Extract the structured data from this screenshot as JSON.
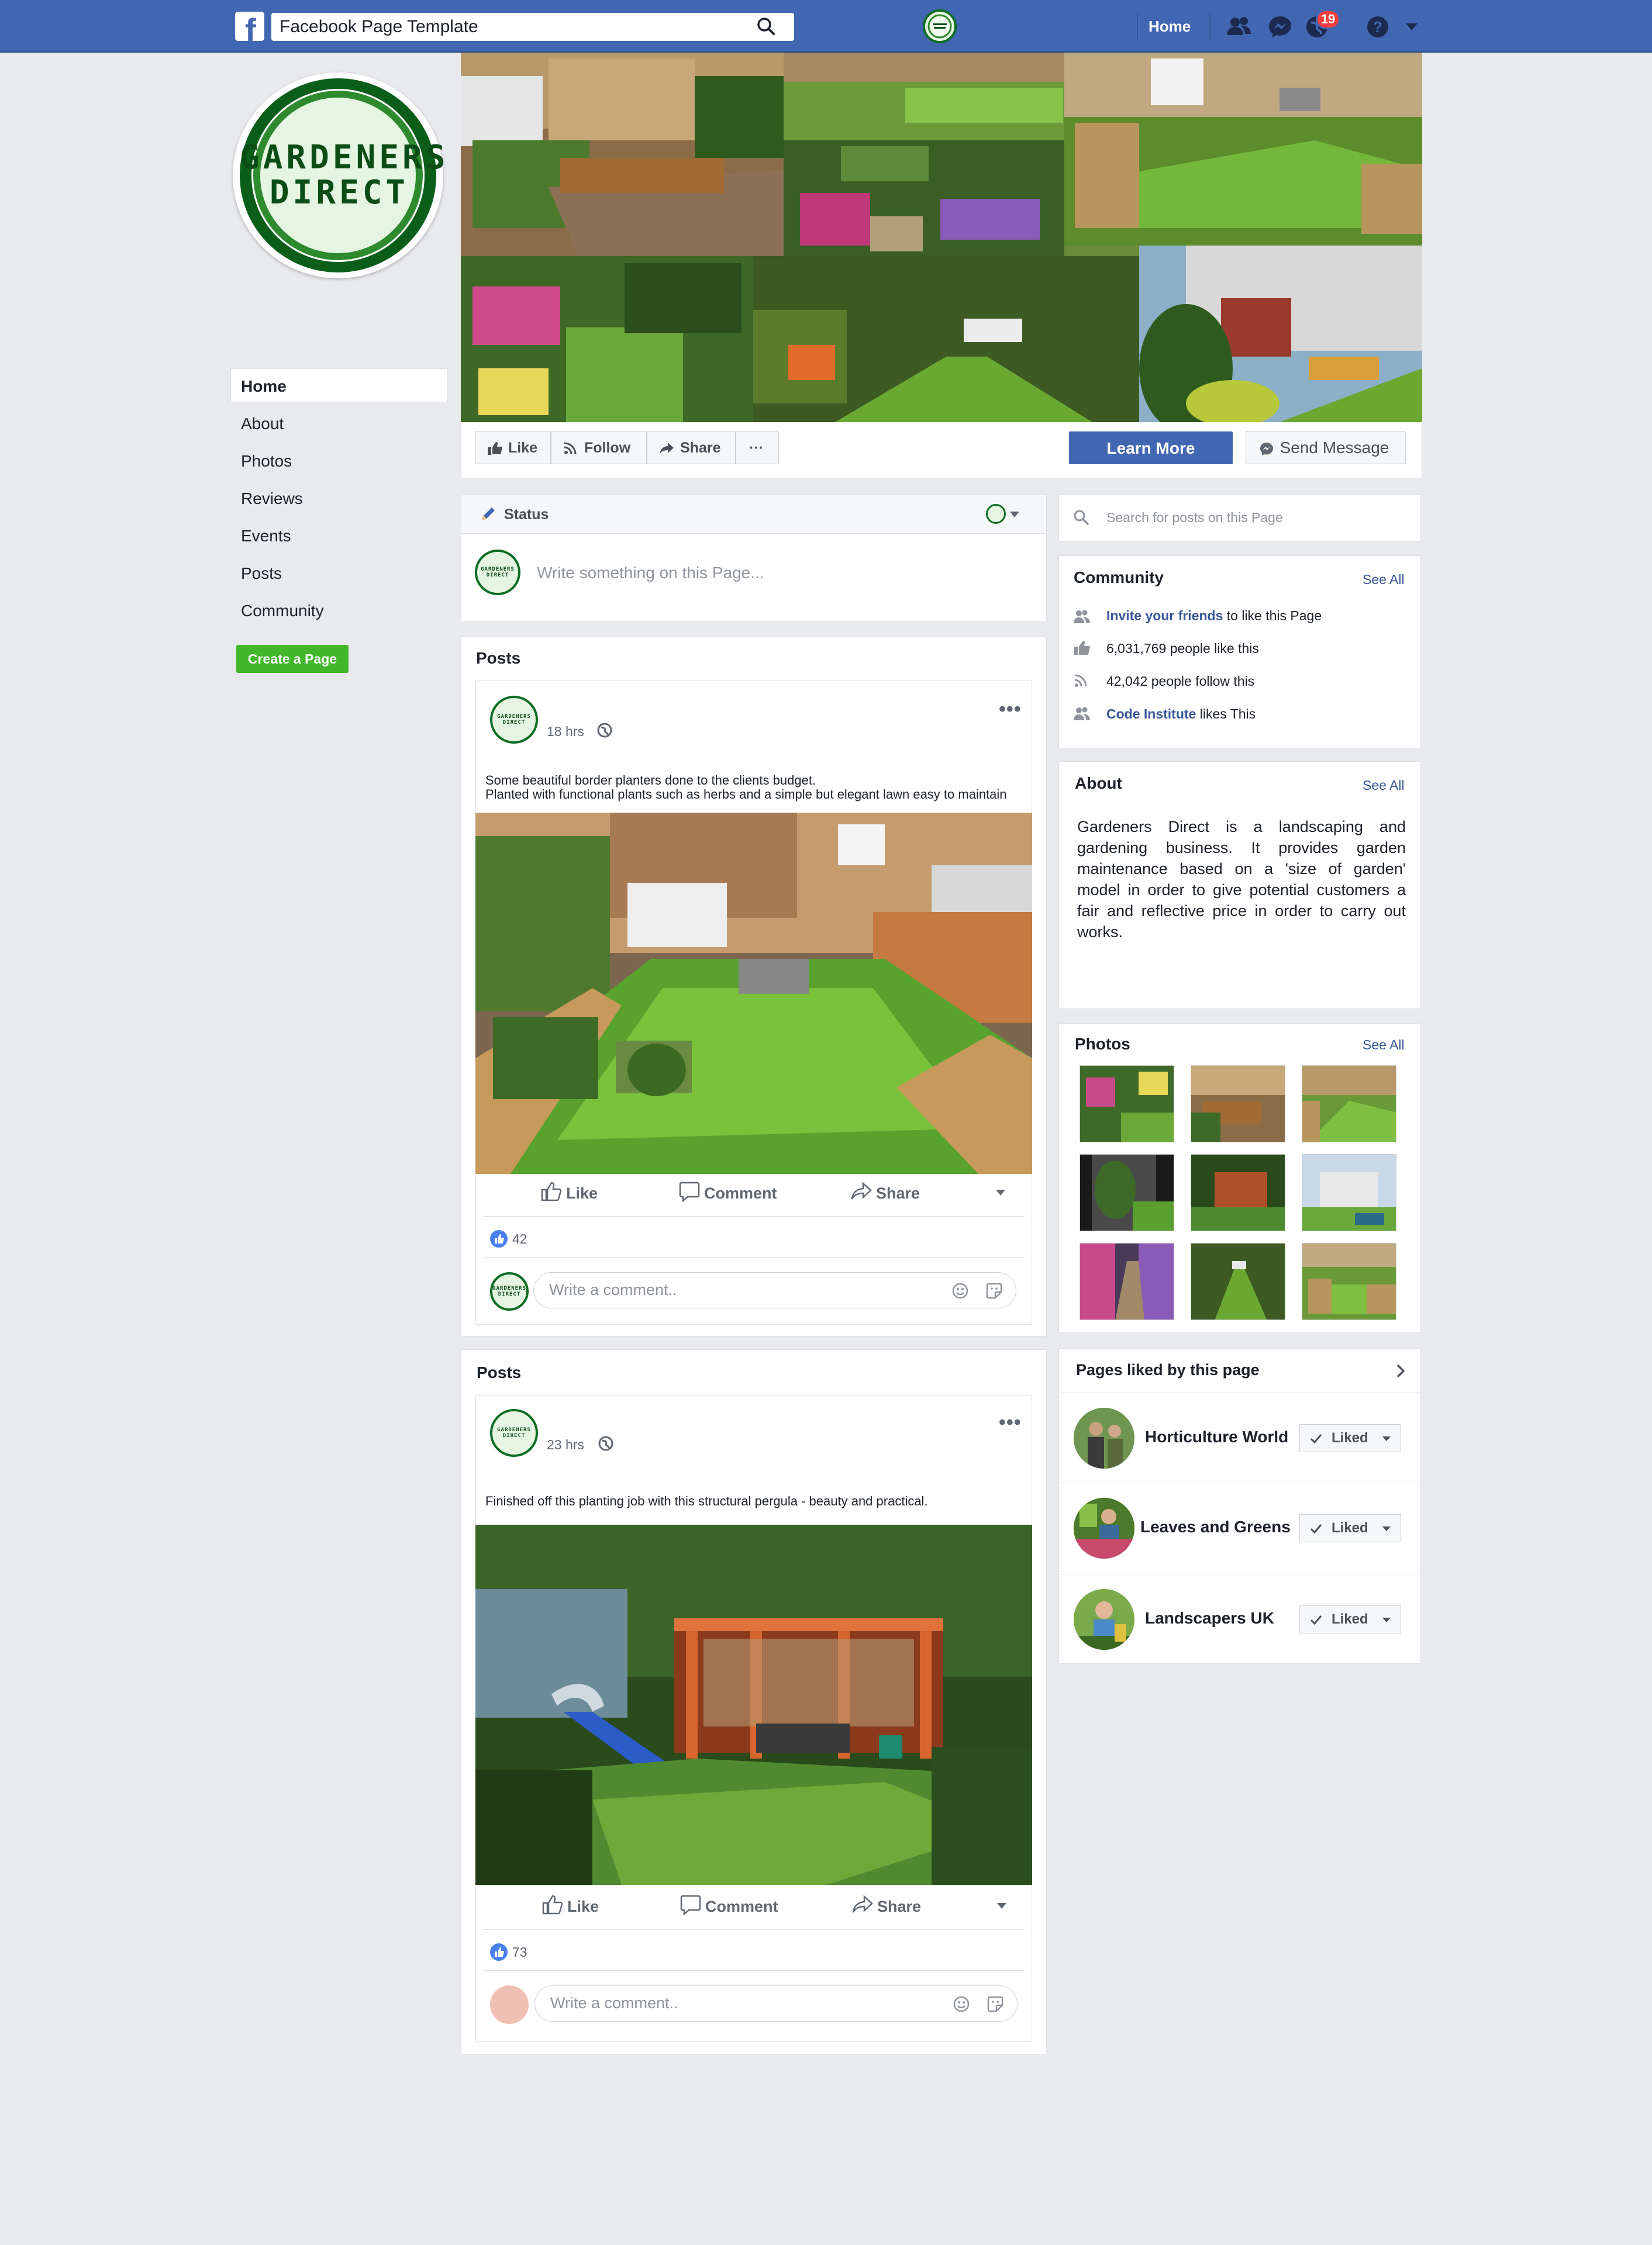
{
  "topbar": {
    "search_value": "Facebook Page Template",
    "home": "Home",
    "notification_count": "19"
  },
  "profile": {
    "logo_line1": "GARDENERS",
    "logo_line2": "DIRECT",
    "avatar_text": "GARDENERS DIRECT"
  },
  "left_nav": {
    "items": [
      "Home",
      "About",
      "Photos",
      "Reviews",
      "Events",
      "Posts",
      "Community"
    ],
    "create_page": "Create a Page"
  },
  "actions": {
    "like": "Like",
    "follow": "Follow",
    "share": "Share",
    "more": "···",
    "learn_more": "Learn More",
    "send_message": "Send Message"
  },
  "composer": {
    "status": "Status",
    "placeholder": "Write something on this Page..."
  },
  "posts": [
    {
      "heading": "Posts",
      "time": "18 hrs",
      "text_line1": "Some beautiful border planters done to the clients budget.",
      "text_line2": "Planted with functional plants such as herbs and a simple but elegant lawn easy to maintain",
      "like": "Like",
      "comment": "Comment",
      "share": "Share",
      "reactions": "42",
      "comment_placeholder": "Write a comment.."
    },
    {
      "heading": "Posts",
      "time": "23 hrs",
      "text_line1": "Finished off this planting job with this structural pergula - beauty and practical.",
      "like": "Like",
      "comment": "Comment",
      "share": "Share",
      "reactions": "73",
      "comment_placeholder": "Write a comment.."
    }
  ],
  "sidebar": {
    "search_placeholder": "Search for posts on this Page",
    "community": {
      "title": "Community",
      "see_all": "See All",
      "invite_link": "Invite your friends",
      "invite_rest": " to like this Page",
      "likes": "6,031,769 people like this",
      "follows": "42,042 people follow this",
      "ci_link": "Code Institute",
      "ci_rest": " likes This"
    },
    "about": {
      "title": "About",
      "see_all": "See All",
      "text": "Gardeners Direct is a landscaping and gardening business. It provides garden maintenance based on a 'size of garden' model in order to give potential customers a fair and reflective price in order to carry out works."
    },
    "photos": {
      "title": "Photos",
      "see_all": "See All"
    },
    "pages_liked": {
      "title": "Pages liked by this page",
      "liked": "Liked",
      "pages": [
        "Horticulture World",
        "Leaves and Greens",
        "Landscapers UK"
      ]
    }
  },
  "colors": {
    "brand": "#4267b2",
    "accent_green": "#42b72a",
    "link": "#385898",
    "logo_green": "#0b5e1a"
  }
}
